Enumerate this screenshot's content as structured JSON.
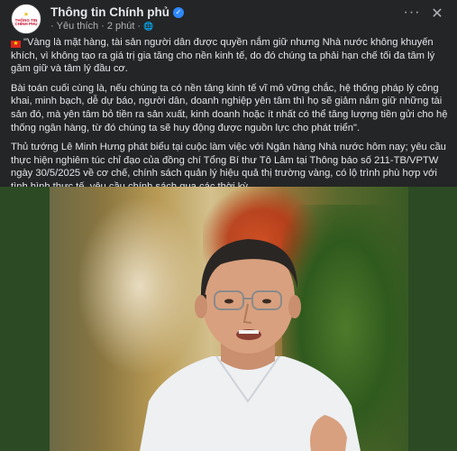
{
  "post": {
    "page_name": "Thông tin Chính phủ",
    "avatar_text": "THÔNG TIN CHÍNH PHỦ",
    "meta": {
      "follow_label": "Yêu thích",
      "separator": "·",
      "time": "2 phút",
      "separator2": "·"
    },
    "icons": {
      "verified": "verified-badge-icon",
      "globe": "globe-icon",
      "more": "more-options-icon",
      "close": "close-icon",
      "flag": "vietnam-flag-icon"
    },
    "paragraphs": [
      "\"Vàng là mặt hàng, tài sản người dân được quyền nắm giữ nhưng Nhà nước không khuyến khích, vì không tạo ra giá trị gia tăng cho nền kinh tế, do đó chúng ta phải hạn chế tối đa tâm lý găm giữ và tâm lý đầu cơ.",
      "Bài toán cuối cùng là, nếu chúng ta có nền tảng kinh tế vĩ mô vững chắc, hệ thống pháp lý công khai, minh bạch, dễ dự báo, người dân, doanh nghiệp yên tâm thì họ sẽ giảm nắm giữ những tài sản đó, mà yên tâm bỏ tiền ra sản xuất, kinh doanh hoặc ít nhất có thể tăng lượng tiền gửi cho hệ thống ngân hàng, từ đó chúng ta sẽ huy động được nguồn lực cho phát triển\".",
      "Thủ tướng Lê Minh Hưng phát biểu tại cuộc làm việc với Ngân hàng Nhà nước hôm nay; yêu cầu thực hiện nghiêm túc chỉ đạo của đồng chí Tổng Bí thư Tô Lâm tại Thông báo số 211-TB/VPTW ngày 30/5/2025 về cơ chế, chính sách quản lý hiệu quả thị trường vàng, có lộ trình phù hợp với tình hình thực tế, yêu cầu chính sách qua các thời kỳ."
    ],
    "colors": {
      "background": "#242526",
      "text": "#e4e6eb",
      "secondary_text": "#b0b3b8",
      "verified_blue": "#2d88ff"
    }
  }
}
